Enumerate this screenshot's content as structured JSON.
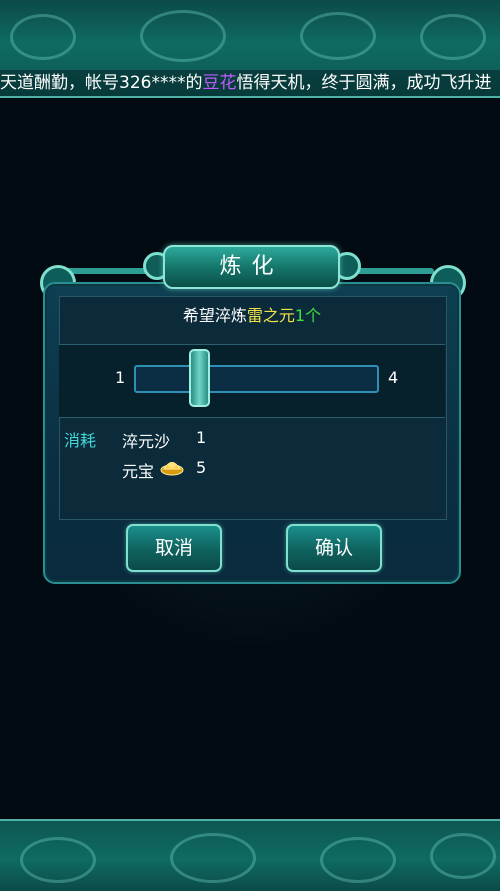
{
  "ticker": {
    "prefix": "天道酬勤，帐号326****的",
    "name": "豆花",
    "suffix": "悟得天机，终于圆满，成功飞升进"
  },
  "dialog": {
    "title": "炼化",
    "description": {
      "prefix": "希望淬炼",
      "item_name": "雷之元",
      "count": "1个"
    },
    "slider": {
      "min_label": "1",
      "max_label": "4",
      "value": 2
    },
    "cost": {
      "label": "消耗",
      "items": [
        {
          "name": "淬元沙",
          "amount": "1"
        },
        {
          "name": "元宝",
          "amount": "5",
          "icon": "gold-ingot-icon"
        }
      ]
    },
    "buttons": {
      "cancel": "取消",
      "confirm": "确认"
    }
  },
  "colors": {
    "item_name": "#f2e34a",
    "count": "#3fe03f",
    "cost_label": "#43d9d9",
    "highlight_name": "#c05cff"
  }
}
